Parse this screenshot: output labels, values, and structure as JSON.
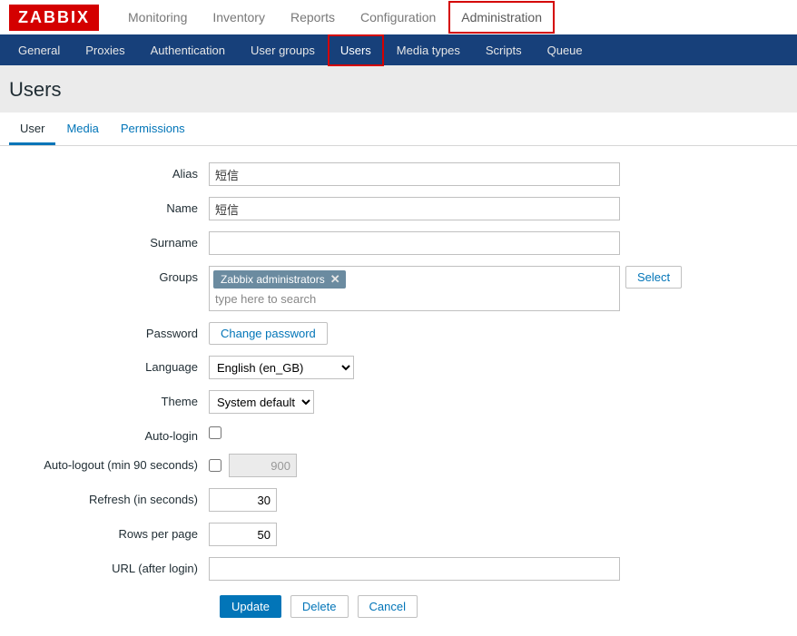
{
  "logo": "ZABBIX",
  "topnav": {
    "items": [
      {
        "label": "Monitoring"
      },
      {
        "label": "Inventory"
      },
      {
        "label": "Reports"
      },
      {
        "label": "Configuration"
      },
      {
        "label": "Administration",
        "active": true
      }
    ]
  },
  "subnav": {
    "items": [
      {
        "label": "General"
      },
      {
        "label": "Proxies"
      },
      {
        "label": "Authentication"
      },
      {
        "label": "User groups"
      },
      {
        "label": "Users",
        "active": true
      },
      {
        "label": "Media types"
      },
      {
        "label": "Scripts"
      },
      {
        "label": "Queue"
      }
    ]
  },
  "page_title": "Users",
  "tabs": [
    {
      "label": "User",
      "active": true
    },
    {
      "label": "Media"
    },
    {
      "label": "Permissions"
    }
  ],
  "form": {
    "alias": {
      "label": "Alias",
      "value": "短信"
    },
    "name": {
      "label": "Name",
      "value": "短信"
    },
    "surname": {
      "label": "Surname",
      "value": ""
    },
    "groups": {
      "label": "Groups",
      "tags": [
        "Zabbix administrators"
      ],
      "placeholder": "type here to search",
      "select_button": "Select"
    },
    "password": {
      "label": "Password",
      "button": "Change password"
    },
    "language": {
      "label": "Language",
      "value": "English (en_GB)"
    },
    "theme": {
      "label": "Theme",
      "value": "System default"
    },
    "auto_login": {
      "label": "Auto-login",
      "checked": false
    },
    "auto_logout": {
      "label": "Auto-logout (min 90 seconds)",
      "checked": false,
      "value": "900"
    },
    "refresh": {
      "label": "Refresh (in seconds)",
      "value": "30"
    },
    "rows_per_page": {
      "label": "Rows per page",
      "value": "50"
    },
    "url_after_login": {
      "label": "URL (after login)",
      "value": ""
    }
  },
  "actions": {
    "update": "Update",
    "delete": "Delete",
    "cancel": "Cancel"
  }
}
